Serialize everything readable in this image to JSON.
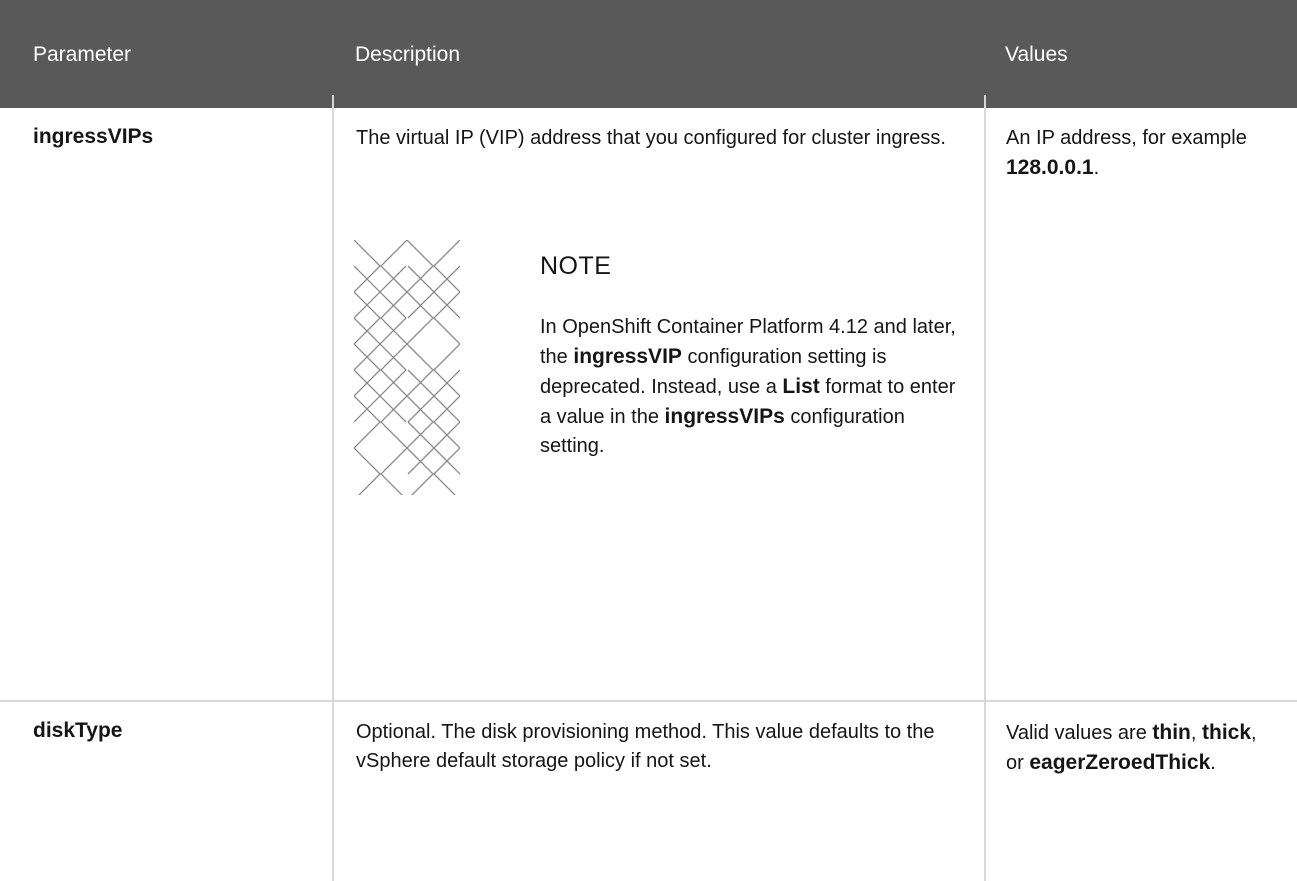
{
  "table": {
    "headers": [
      "Parameter",
      "Description",
      "Values"
    ],
    "rows": [
      {
        "parameter": "ingressVIPs",
        "description": "The virtual IP (VIP) address that you configured for cluster ingress.",
        "values_prefix": "An IP address, for example ",
        "values_bold": "128.0.0.1",
        "values_suffix": ".",
        "note": {
          "title": "NOTE",
          "t1": "In OpenShift Container Platform 4.12 and later, the ",
          "b1": "ingressVIP",
          "t2": " configuration setting is deprecated. Instead, use a ",
          "b2": "List",
          "t3": " format to enter a value in the ",
          "b3": "ingressVIPs",
          "t4": " configuration setting."
        }
      },
      {
        "parameter": "diskType",
        "description": "Optional. The disk provisioning method. This value defaults to the vSphere default storage policy if not set.",
        "values_prefix": "Valid values are ",
        "values_b1": "thin",
        "values_t1": ", ",
        "values_b2": "thick",
        "values_t2": ", or ",
        "values_b3": "eagerZeroedThick",
        "values_t3": "."
      }
    ]
  }
}
